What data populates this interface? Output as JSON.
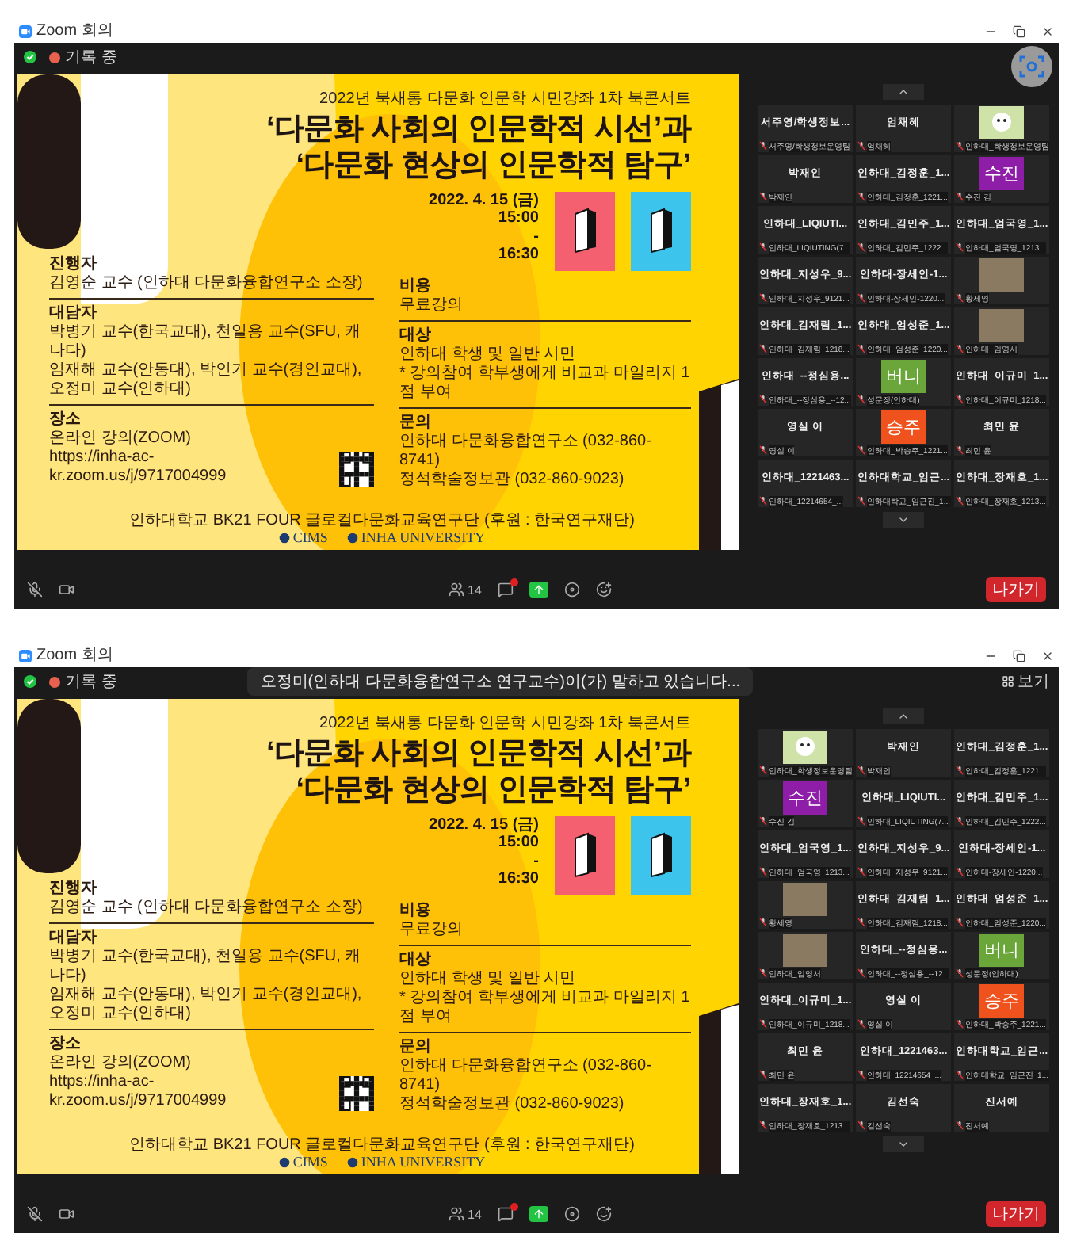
{
  "windows": [
    {
      "title": "Zoom 회의",
      "recording": "기록 중",
      "floating_camera": true,
      "slide": {
        "subtitle": "2022년 북새통 다문화 인문학 시민강좌 1차 북콘서트",
        "title_lines": [
          "‘다문화 사회의 인문학적 시선’과",
          "‘다문화 현상의 인문학적 탐구’"
        ],
        "date_lines": [
          "2022. 4. 15 (금)",
          "15:00",
          "-",
          "16:30"
        ],
        "books": [
          {
            "color": "#f4606f"
          },
          {
            "color": "#3cc4ec"
          }
        ],
        "left_sections": [
          {
            "heading": "진행자",
            "lines": [
              "김영순 교수 (인하대 다문화융합연구소 소장)"
            ]
          },
          {
            "heading": "대담자",
            "lines": [
              "박병기 교수(한국교대), 천일용 교수(SFU, 캐나다)",
              "임재해 교수(안동대), 박인기 교수(경인교대), 오정미 교수(인하대)"
            ]
          },
          {
            "heading": "장소",
            "lines": [
              "온라인 강의(ZOOM)",
              "https://inha-ac-kr.zoom.us/j/9717004999"
            ],
            "qr_code": true
          }
        ],
        "right_sections": [
          {
            "heading": "비용",
            "lines": [
              "무료강의"
            ]
          },
          {
            "heading": "대상",
            "lines": [
              "인하대 학생 및 일반 시민",
              "* 강의참여 학부생에게 비교과 마일리지 1점 부여"
            ]
          },
          {
            "heading": "문의",
            "lines": [
              "인하대 다문화융합연구소 (032-860-8741)",
              "정석학술정보관 (032-860-9023)"
            ]
          }
        ],
        "sponsor": "인하대학교 BK21 FOUR 글로컬다문화교육연구단 (후원 : 한국연구재단)",
        "logos": [
          "CIMS",
          "INHA UNIVERSITY"
        ]
      },
      "gallery": {
        "tiles": [
          {
            "kind": "name",
            "name": "서주영/학생정보...",
            "label": "서주영/학생정보운영팀"
          },
          {
            "kind": "name",
            "name": "엄채혜",
            "label": "엄채혜"
          },
          {
            "kind": "avatar",
            "label": "인하대_학생정보운영팀"
          },
          {
            "kind": "name",
            "name": "박재인",
            "label": "박재인"
          },
          {
            "kind": "name",
            "name": "인하대_김정훈_1...",
            "label": "인하대_김정훈_1221..."
          },
          {
            "kind": "initials",
            "name": "수진",
            "label": "수진 김",
            "color": "#8e1ea8"
          },
          {
            "kind": "name",
            "name": "인하대_LIQIUTI...",
            "label": "인하대_LIQIUTING(7..."
          },
          {
            "kind": "name",
            "name": "인하대_김민주_1...",
            "label": "인하대_김민주_1222..."
          },
          {
            "kind": "name",
            "name": "인하대_엄국영_1...",
            "label": "인하대_엄국영_1213..."
          },
          {
            "kind": "name",
            "name": "인하대_지성우_9...",
            "label": "인하대_지성우_9121..."
          },
          {
            "kind": "name",
            "name": "인하대-장세인-1...",
            "label": "인하대-장세인-1220..."
          },
          {
            "kind": "photo",
            "label": "황세영"
          },
          {
            "kind": "name",
            "name": "인하대_김재림_1...",
            "label": "인하대_김재림_1218..."
          },
          {
            "kind": "name",
            "name": "인하대_엄성준_1...",
            "label": "인하대_엄성준_1220..."
          },
          {
            "kind": "photo",
            "label": "인하대_임영서"
          },
          {
            "kind": "name",
            "name": "인하대_--정심용...",
            "label": "인하대_--정심용_--12..."
          },
          {
            "kind": "initials",
            "name": "버니",
            "label": "성문정(인하대)",
            "color": "#6aa63a"
          },
          {
            "kind": "name",
            "name": "인하대_이규미_1...",
            "label": "인하대_이규미_1218..."
          },
          {
            "kind": "name",
            "name": "영실 이",
            "label": "영실 이"
          },
          {
            "kind": "initials",
            "name": "승주",
            "label": "인하대_박승주_1221...",
            "color": "#f0521e"
          },
          {
            "kind": "name",
            "name": "최민 윤",
            "label": "최민 윤"
          },
          {
            "kind": "name",
            "name": "인하대_1221463...",
            "label": "인하대_12214654_..."
          },
          {
            "kind": "name",
            "name": "인하대학교_임근...",
            "label": "인하대학교_임근진_1..."
          },
          {
            "kind": "name",
            "name": "인하대_장재호_1...",
            "label": "인하대_장재호_1213..."
          }
        ]
      },
      "toolbar": {
        "participants": "14",
        "leave": "나가기"
      }
    },
    {
      "title": "Zoom 회의",
      "recording": "기록 중",
      "notification": "오정미(인하대 다문화융합연구소 연구교수)이(가) 말하고 있습니다...",
      "view_button": "보기",
      "slide": {
        "subtitle": "2022년 북새통 다문화 인문학 시민강좌 1차 북콘서트",
        "title_lines": [
          "‘다문화 사회의 인문학적 시선’과",
          "‘다문화 현상의 인문학적 탐구’"
        ],
        "date_lines": [
          "2022. 4. 15 (금)",
          "15:00",
          "-",
          "16:30"
        ],
        "books": [
          {
            "color": "#f4606f"
          },
          {
            "color": "#3cc4ec"
          }
        ],
        "left_sections": [
          {
            "heading": "진행자",
            "lines": [
              "김영순 교수 (인하대 다문화융합연구소 소장)"
            ]
          },
          {
            "heading": "대담자",
            "lines": [
              "박병기 교수(한국교대), 천일용 교수(SFU, 캐나다)",
              "임재해 교수(안동대), 박인기 교수(경인교대), 오정미 교수(인하대)"
            ]
          },
          {
            "heading": "장소",
            "lines": [
              "온라인 강의(ZOOM)",
              "https://inha-ac-kr.zoom.us/j/9717004999"
            ],
            "qr_code": true
          }
        ],
        "right_sections": [
          {
            "heading": "비용",
            "lines": [
              "무료강의"
            ]
          },
          {
            "heading": "대상",
            "lines": [
              "인하대 학생 및 일반 시민",
              "* 강의참여 학부생에게 비교과 마일리지 1점 부여"
            ]
          },
          {
            "heading": "문의",
            "lines": [
              "인하대 다문화융합연구소 (032-860-8741)",
              "정석학술정보관 (032-860-9023)"
            ]
          }
        ],
        "sponsor": "인하대학교 BK21 FOUR 글로컬다문화교육연구단 (후원 : 한국연구재단)",
        "logos": [
          "CIMS",
          "INHA UNIVERSITY"
        ]
      },
      "gallery": {
        "tiles": [
          {
            "kind": "avatar",
            "label": "인하대_학생정보운영팀"
          },
          {
            "kind": "name",
            "name": "박재인",
            "label": "박재인"
          },
          {
            "kind": "name",
            "name": "인하대_김정훈_1...",
            "label": "인하대_김정훈_1221..."
          },
          {
            "kind": "initials",
            "name": "수진",
            "label": "수진 김",
            "color": "#8e1ea8"
          },
          {
            "kind": "name",
            "name": "인하대_LIQIUTI...",
            "label": "인하대_LIQIUTING(7..."
          },
          {
            "kind": "name",
            "name": "인하대_김민주_1...",
            "label": "인하대_김민주_1222..."
          },
          {
            "kind": "name",
            "name": "인하대_엄국영_1...",
            "label": "인하대_엄국영_1213..."
          },
          {
            "kind": "name",
            "name": "인하대_지성우_9...",
            "label": "인하대_지성우_9121..."
          },
          {
            "kind": "name",
            "name": "인하대-장세인-1...",
            "label": "인하대-장세인-1220..."
          },
          {
            "kind": "photo",
            "label": "황세영"
          },
          {
            "kind": "name",
            "name": "인하대_김재림_1...",
            "label": "인하대_김재림_1218..."
          },
          {
            "kind": "name",
            "name": "인하대_엄성준_1...",
            "label": "인하대_엄성준_1220..."
          },
          {
            "kind": "photo",
            "label": "인하대_임영서"
          },
          {
            "kind": "name",
            "name": "인하대_--정심용...",
            "label": "인하대_--정심용_--12..."
          },
          {
            "kind": "initials",
            "name": "버니",
            "label": "성문정(인하대)",
            "color": "#6aa63a"
          },
          {
            "kind": "name",
            "name": "인하대_이규미_1...",
            "label": "인하대_이규미_1218..."
          },
          {
            "kind": "name",
            "name": "영실 이",
            "label": "영실 이"
          },
          {
            "kind": "initials",
            "name": "승주",
            "label": "인하대_박승주_1221...",
            "color": "#f0521e"
          },
          {
            "kind": "name",
            "name": "최민 윤",
            "label": "최민 윤"
          },
          {
            "kind": "name",
            "name": "인하대_1221463...",
            "label": "인하대_12214654_..."
          },
          {
            "kind": "name",
            "name": "인하대학교_임근...",
            "label": "인하대학교_임근진_1..."
          },
          {
            "kind": "name",
            "name": "인하대_장재호_1...",
            "label": "인하대_장재호_1213..."
          },
          {
            "kind": "name",
            "name": "김선숙",
            "label": "김선숙"
          },
          {
            "kind": "name",
            "name": "진서예",
            "label": "진서예"
          }
        ]
      },
      "toolbar": {
        "participants": "14",
        "leave": "나가기"
      }
    }
  ]
}
